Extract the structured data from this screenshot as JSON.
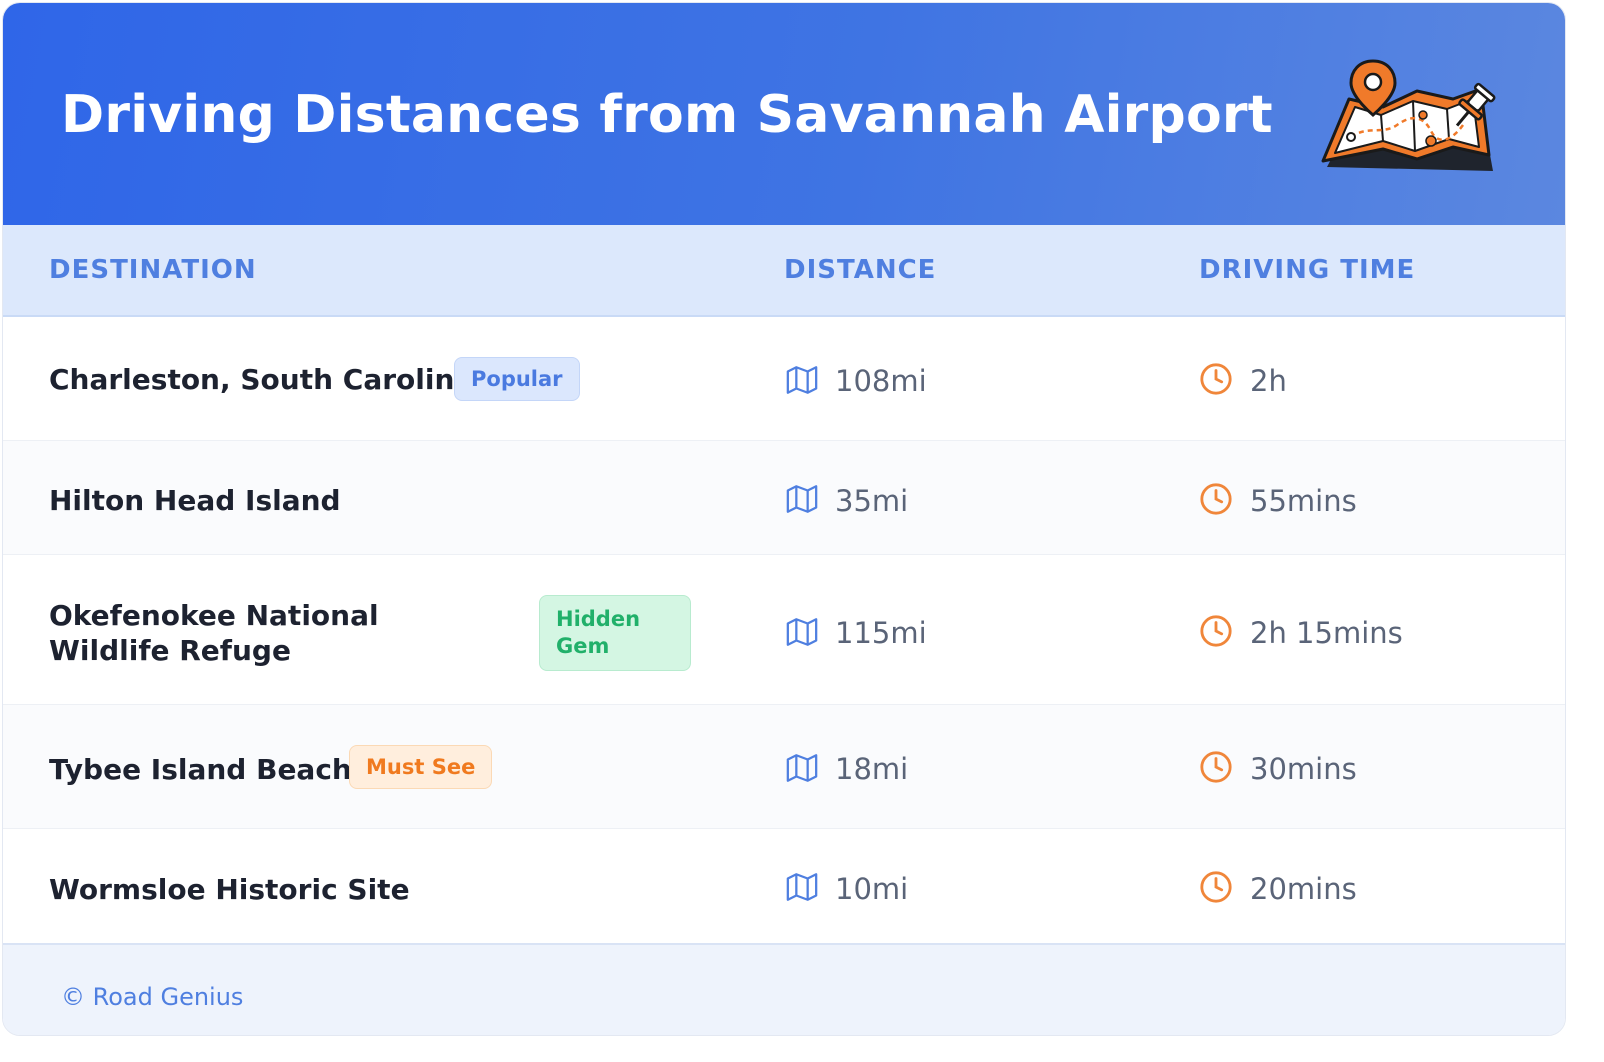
{
  "header": {
    "title": "Driving Distances from Savannah Airport",
    "illustration": "map-with-pins-icon"
  },
  "table": {
    "columns": [
      "DESTINATION",
      "DISTANCE",
      "DRIVING TIME"
    ],
    "rows": [
      {
        "destination": "Charleston, South Carolina",
        "badge": "Popular",
        "badge_color": "#4a7ae0",
        "distance": "108mi",
        "time": "2h"
      },
      {
        "destination": "Hilton Head Island",
        "badge": "",
        "distance": "35mi",
        "time": "55mins"
      },
      {
        "destination": "Okefenokee National Wildlife Refuge",
        "badge": "Hidden Gem",
        "badge_color": "#21b06a",
        "distance": "115mi",
        "time": "2h 15mins"
      },
      {
        "destination": "Tybee Island Beach",
        "badge": "Must See",
        "badge_color": "#f07a1f",
        "distance": "18mi",
        "time": "30mins"
      },
      {
        "destination": "Wormsloe Historic Site",
        "badge": "",
        "distance": "10mi",
        "time": "20mins"
      }
    ],
    "distance_icon": "map-icon",
    "time_icon": "clock-icon"
  },
  "footer": {
    "text": "© Road Genius"
  },
  "colors": {
    "header_gradient_start": "#2f66e8",
    "header_gradient_end": "#5b87e0",
    "accent_blue": "#4f7fe0",
    "clock_orange": "#f0863a"
  }
}
